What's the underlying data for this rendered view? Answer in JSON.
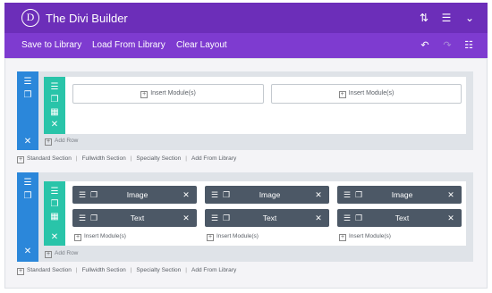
{
  "header": {
    "logo_letter": "D",
    "title": "The Divi Builder"
  },
  "toolbar": {
    "save": "Save to Library",
    "load": "Load From Library",
    "clear": "Clear Layout"
  },
  "sections": [
    {
      "rows": [
        {
          "columns": [
            {
              "insert_label": "Insert Module(s)"
            },
            {
              "insert_label": "Insert Module(s)"
            }
          ]
        }
      ],
      "add_row": "Add Row",
      "links": [
        "Standard Section",
        "Fullwidth Section",
        "Specialty Section",
        "Add From Library"
      ]
    },
    {
      "rows": [
        {
          "columns": [
            {
              "modules": [
                "Image",
                "Text"
              ],
              "insert_label": "Insert Module(s)"
            },
            {
              "modules": [
                "Image",
                "Text"
              ],
              "insert_label": "Insert Module(s)"
            },
            {
              "modules": [
                "Image",
                "Text"
              ],
              "insert_label": "Insert Module(s)"
            }
          ]
        }
      ],
      "add_row": "Add Row",
      "links": [
        "Standard Section",
        "Fullwidth Section",
        "Specialty Section",
        "Add From Library"
      ]
    }
  ],
  "colors": {
    "header": "#6c2eb9",
    "toolbar": "#7e3bd0",
    "section_bar": "#2b87da",
    "row_bar": "#29c4a9",
    "module": "#4c5866"
  },
  "icons": {
    "sort": "sort-icon",
    "menu": "hamburger-icon",
    "collapse": "chevron-down-icon",
    "undo": "undo-icon",
    "redo": "redo-icon",
    "history": "history-icon"
  }
}
